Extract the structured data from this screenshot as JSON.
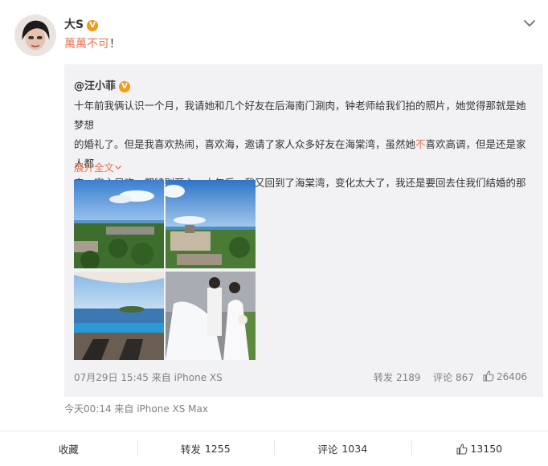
{
  "post": {
    "author": "大S",
    "verified_badge": "V",
    "text_part1": "萬萬不可",
    "text_part2": "！",
    "time_source": "今天00:14  来自 iPhone XS Max",
    "menu_icon": "chevron-down-icon"
  },
  "repost": {
    "author": "@汪小菲",
    "verified_badge": "V",
    "text_line1": "十年前我俩认识一个月，我请她和几个好友在后海南门涮肉，钟老师给我们拍的照片，她觉得那就是她梦想",
    "text_line2a": "的婚礼了。但是我喜欢热闹，喜欢海，邀请了家人众多好友在海棠湾，虽然她",
    "text_line2_hl": "不",
    "text_line2b": "喜欢高调，但是还是家人都",
    "text_line3": "来，宾主尽欢，都特别开心。十年后，我又回到了海棠湾，变化太大了，我还是要回去住我们结婚的那个",
    "expand_label": "展开全文",
    "time_source": "07月29日 15:45 来自 iPhone XS",
    "repost_label": "转发",
    "repost_count": "2189",
    "comment_label": "评论",
    "comment_count": "867",
    "like_count": "26406"
  },
  "actions": {
    "favorite_label": "收藏",
    "repost_label": "转发",
    "repost_count": "1255",
    "comment_label": "评论",
    "comment_count": "1034",
    "like_count": "13150"
  },
  "colors": {
    "accent": "#eb7350",
    "badge": "#f39a1a",
    "panel_bg": "#f2f2f5",
    "meta_text": "#808080"
  }
}
